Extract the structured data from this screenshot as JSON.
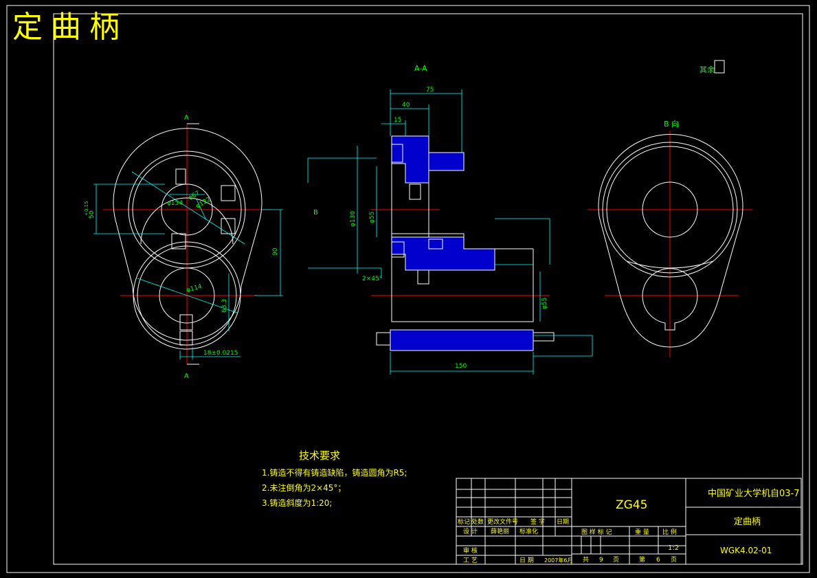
{
  "title": "定曲柄",
  "section_label": "A-A",
  "view_label_b": "B 向",
  "section_marks": [
    "A",
    "A"
  ],
  "arrow_b": "B",
  "surface_note": "其余",
  "dimensions": {
    "d154": "φ154",
    "d67": "φ67",
    "d122": "φ122",
    "d114": "φ114",
    "d130": "φ130",
    "d55a": "φ55",
    "d55b": "φ55",
    "h50": "50",
    "h90": "90",
    "h63": "63.3",
    "key18": "18±0.0215",
    "l75": "75",
    "l40": "40",
    "l15": "15",
    "l150": "150",
    "chamfer": "2×45°",
    "tol_p": "+0.15",
    "tol_m": "-0.05"
  },
  "tech_requirements": {
    "title": "技术要求",
    "items": [
      "1.铸造不得有铸造缺陷，铸造圆角为R5;",
      "2.未注倒角为2×45°；",
      "3.铸造斜度为1:20;"
    ]
  },
  "title_block": {
    "material": "ZG45",
    "school": "中国矿业大学机自03-7",
    "part_name": "定曲柄",
    "drawing_no": "WGK4.02-01",
    "scale": "1:2",
    "labels": {
      "mark": "标记",
      "count": "处数",
      "change_doc": "更改文件号",
      "sign": "签 字",
      "date_h": "日期",
      "design": "设 计",
      "designer": "薛艳丽",
      "std": "标准化",
      "stage": "图 样 标 记",
      "weight": "重 量",
      "ratio": "比 例",
      "review": "审 核",
      "process": "工 艺",
      "date": "日 期",
      "date_val": "2007年6月",
      "total": "共",
      "total_n": "9",
      "page_u": "页",
      "sheet": "第",
      "sheet_n": "6",
      "page_u2": "页"
    }
  },
  "colors": {
    "frame": "#ffffff",
    "centerline": "#ff0000",
    "dimension": "#00ffff",
    "text": "#00ff00",
    "title": "#ffff00",
    "hatch": "#0000ff",
    "part": "#ffff66"
  }
}
